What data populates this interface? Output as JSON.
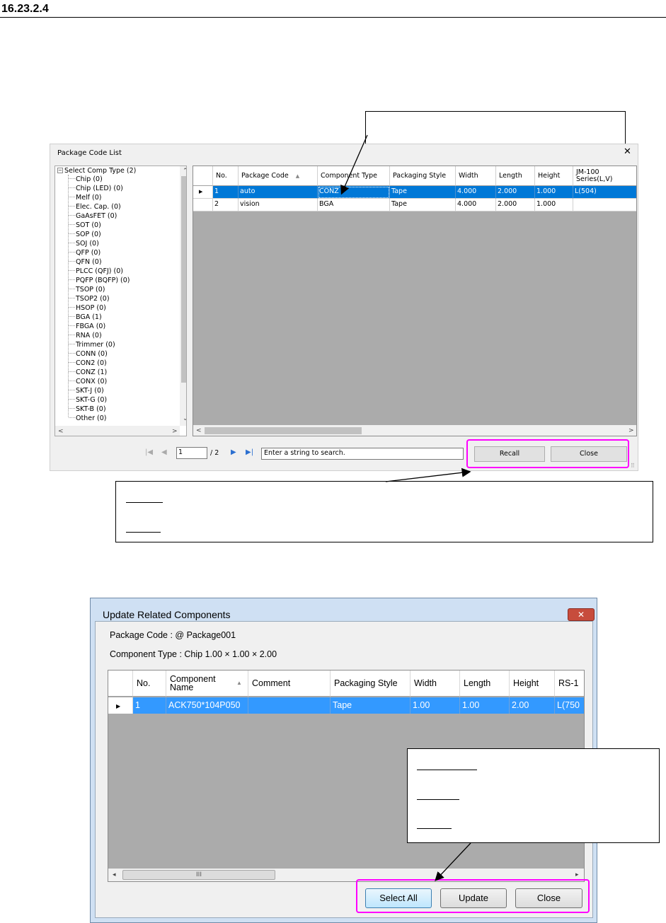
{
  "section": {
    "number": "16.23.2.4"
  },
  "window1": {
    "title": "Package Code List",
    "close_glyph": "✕",
    "tree": {
      "root": "Select Comp Type (2)",
      "items": [
        "Chip (0)",
        "Chip (LED) (0)",
        "Melf (0)",
        "Elec. Cap. (0)",
        "GaAsFET (0)",
        "SOT (0)",
        "SOP (0)",
        "SOJ (0)",
        "QFP (0)",
        "QFN (0)",
        "PLCC (QFJ) (0)",
        "PQFP (BQFP) (0)",
        "TSOP (0)",
        "TSOP2 (0)",
        "HSOP (0)",
        "BGA (1)",
        "FBGA (0)",
        "RNA (0)",
        "Trimmer (0)",
        "CONN (0)",
        "CON2 (0)",
        "CONZ (1)",
        "CONX (0)",
        "SKT-J (0)",
        "SKT-G (0)",
        "SKT-B (0)",
        "Other (0)"
      ]
    },
    "grid": {
      "headers": [
        "No.",
        "Package Code",
        "Component Type",
        "Packaging Style",
        "Width",
        "Length",
        "Height",
        "JM-100 Series(L,V)"
      ],
      "rows": [
        [
          "1",
          "auto",
          "CONZ",
          "Tape",
          "4.000",
          "2.000",
          "1.000",
          "L(504)"
        ],
        [
          "2",
          "vision",
          "BGA",
          "Tape",
          "4.000",
          "2.000",
          "1.000",
          ""
        ]
      ]
    },
    "nav": {
      "page": "1",
      "total": "/ 2",
      "search_placeholder": "Enter a string to search."
    },
    "buttons": {
      "recall": "Recall",
      "close": "Close"
    }
  },
  "window2": {
    "title": "Update Related Components",
    "close_glyph": "✕",
    "package_code": "Package Code : @ Package001",
    "component_type": "Component Type : Chip   1.00 × 1.00 × 2.00",
    "grid": {
      "headers": [
        "No.",
        "Component Name",
        "Comment",
        "Packaging Style",
        "Width",
        "Length",
        "Height",
        "RS-1"
      ],
      "rows": [
        [
          "1",
          "ACK750*104P050",
          "",
          "Tape",
          "1.00",
          "1.00",
          "2.00",
          "L(750"
        ]
      ]
    },
    "scroll_thumb_glyph": "III",
    "buttons": {
      "select_all": "Select All",
      "update": "Update",
      "close": "Close"
    }
  }
}
